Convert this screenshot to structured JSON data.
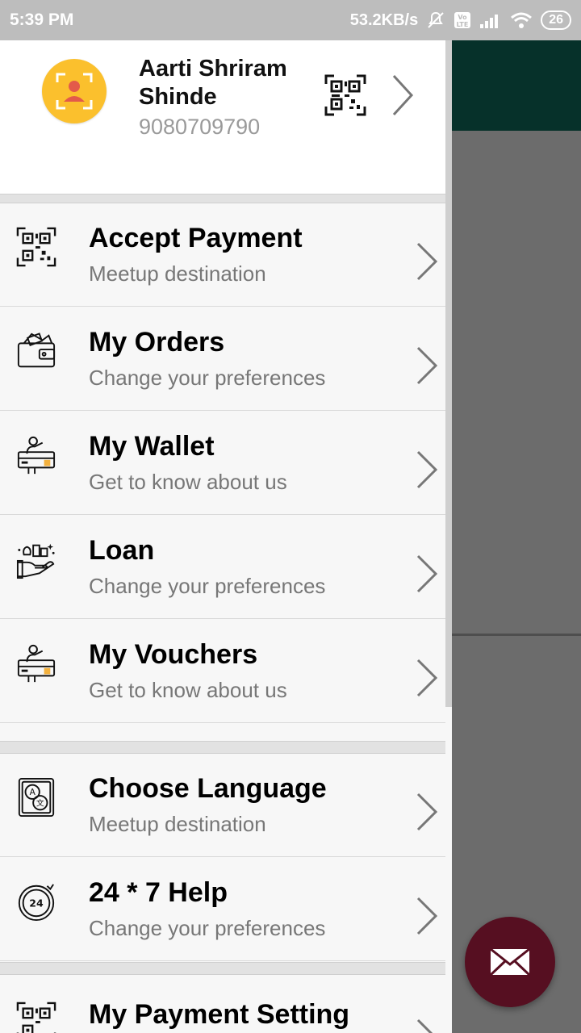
{
  "status_bar": {
    "time": "5:39 PM",
    "net_speed": "53.2KB/s",
    "battery": "26",
    "icons": [
      "mute-icon",
      "volte-icon",
      "signal-icon",
      "wifi-icon",
      "battery-icon"
    ]
  },
  "profile": {
    "name": "Aarti Shriram Shinde",
    "phone": "9080709790",
    "icons": [
      "avatar-icon",
      "qr-code-icon",
      "chevron-right-icon"
    ]
  },
  "menu": {
    "items": [
      {
        "title": "Accept Payment",
        "subtitle": "Meetup destination",
        "icon": "qr-code-icon"
      },
      {
        "title": "My Orders",
        "subtitle": "Change your preferences",
        "icon": "wallet-icon"
      },
      {
        "title": "My Wallet",
        "subtitle": "Get to know about us",
        "icon": "card-person-icon"
      },
      {
        "title": "Loan",
        "subtitle": "Change your preferences",
        "icon": "loan-hand-icon"
      },
      {
        "title": "My Vouchers",
        "subtitle": "Get to know about us",
        "icon": "card-person-icon"
      },
      {
        "title": "Choose Language",
        "subtitle": "Meetup destination",
        "icon": "language-icon"
      },
      {
        "title": "24 * 7 Help",
        "subtitle": "Change your preferences",
        "icon": "clock-24-icon"
      },
      {
        "title": "My Payment Setting",
        "subtitle": "",
        "icon": "qr-code-icon"
      }
    ]
  },
  "fab": {
    "icon": "mail-icon"
  },
  "colors": {
    "toolbar": "#06312a",
    "fab": "#560f21",
    "avatar": "#fbc02d",
    "scrim": "#6c6c6c",
    "status_bar": "#bdbdbd"
  }
}
